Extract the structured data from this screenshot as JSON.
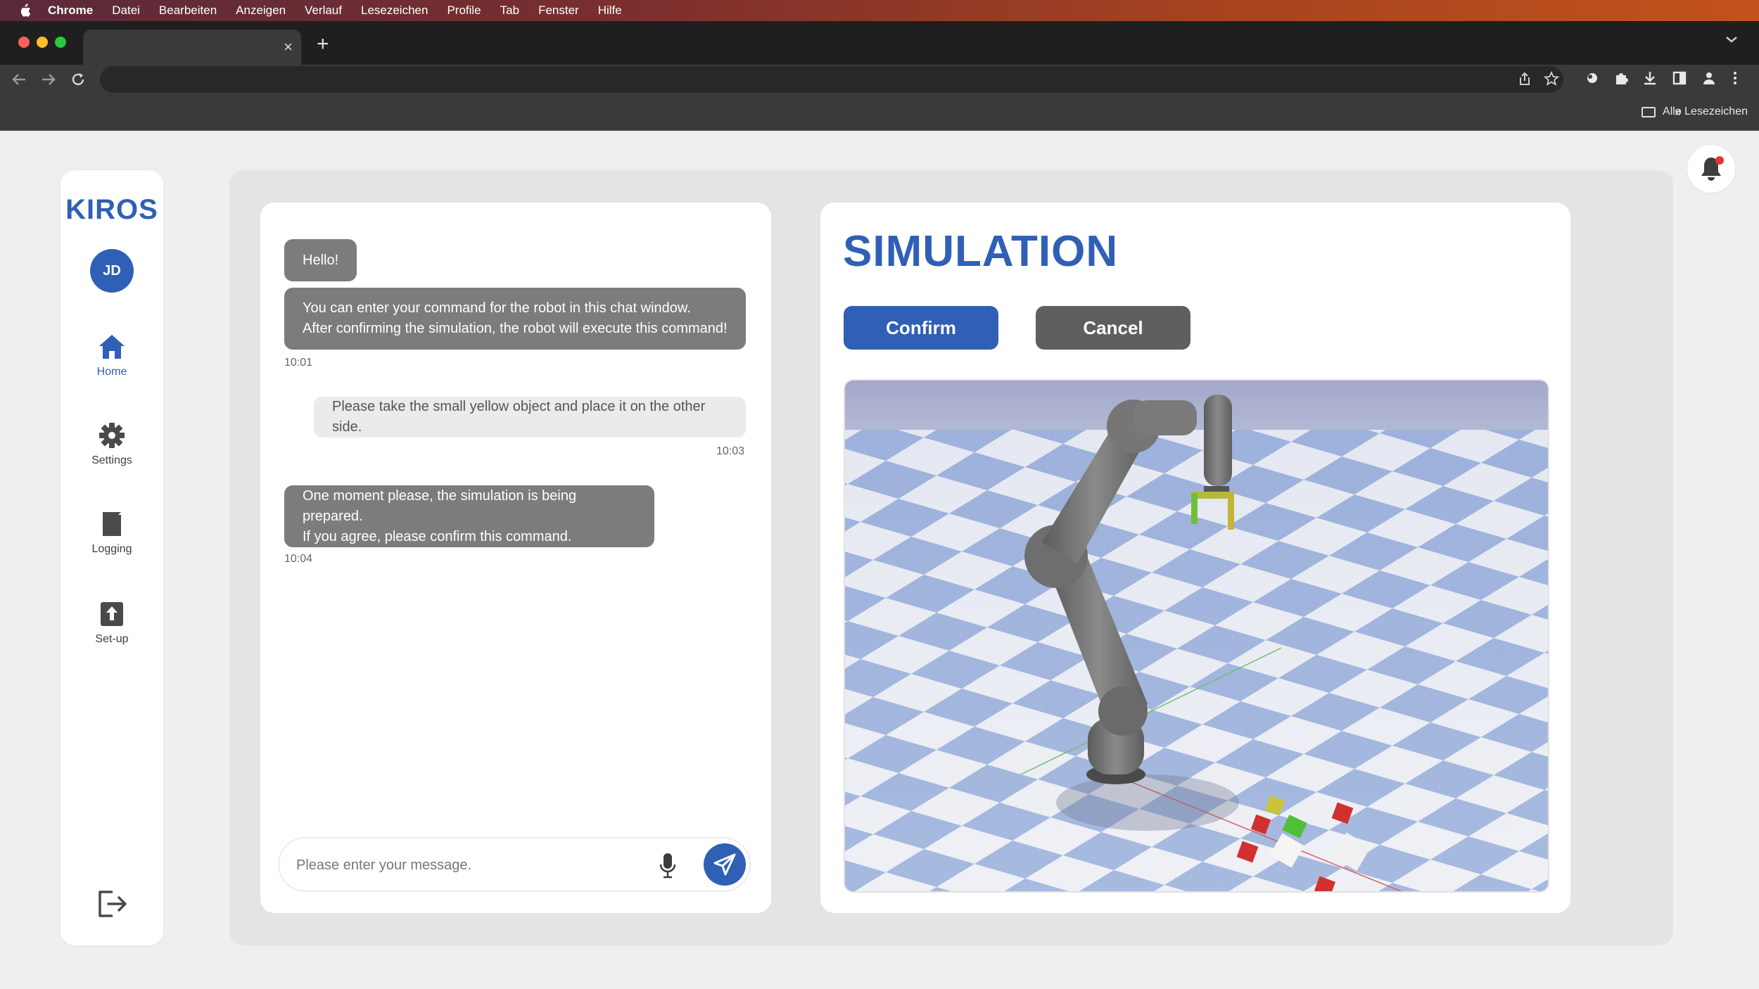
{
  "menubar": {
    "app": "Chrome",
    "items": [
      "Datei",
      "Bearbeiten",
      "Anzeigen",
      "Verlauf",
      "Lesezeichen",
      "Profile",
      "Tab",
      "Fenster",
      "Hilfe"
    ]
  },
  "browser": {
    "tab_close": "×",
    "new_tab": "+",
    "bookmarks_folder": "Alle Lesezeichen",
    "bookmarks_more": "»"
  },
  "sidebar": {
    "logo": "KIROS",
    "avatar_initials": "JD",
    "nav": [
      {
        "label": "Home",
        "icon": "home-icon",
        "active": true
      },
      {
        "label": "Settings",
        "icon": "gear-icon"
      },
      {
        "label": "Logging",
        "icon": "document-icon"
      },
      {
        "label": "Set-up",
        "icon": "upload-icon"
      }
    ],
    "logout_icon": "logout-icon"
  },
  "chat": {
    "messages": [
      {
        "from": "bot",
        "lines": [
          "Hello!"
        ]
      },
      {
        "from": "bot",
        "lines": [
          "You can enter your command for the robot in this chat window.",
          "After confirming the simulation, the robot will execute this command!"
        ],
        "time": "10:01"
      },
      {
        "from": "user",
        "lines": [
          "Please take the small yellow object and place it on the other side."
        ],
        "time": "10:03"
      },
      {
        "from": "bot",
        "lines": [
          "One moment please, the simulation is being prepared.",
          "If you agree, please confirm this command."
        ],
        "time": "10:04"
      }
    ],
    "input_placeholder": "Please enter your message."
  },
  "simulation": {
    "title": "SIMULATION",
    "confirm_label": "Confirm",
    "cancel_label": "Cancel"
  },
  "colors": {
    "accent": "#3060b5",
    "bubble_bot": "#7c7c7c",
    "bubble_user": "#ebebeb",
    "cancel": "#5f5f5f",
    "notification_dot": "#e0392b"
  }
}
